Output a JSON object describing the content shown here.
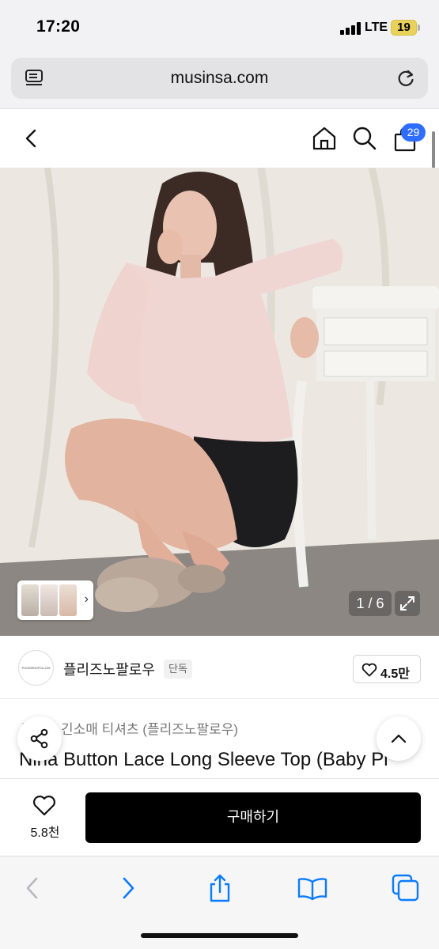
{
  "status_bar": {
    "time": "17:20",
    "network": "LTE",
    "battery": "19"
  },
  "browser": {
    "url": "musinsa.com",
    "reader_icon": "reader-icon",
    "reload_icon": "reload-icon"
  },
  "site_nav": {
    "back_icon": "chevron-left-icon",
    "home_icon": "home-icon",
    "search_icon": "search-icon",
    "cart_icon": "shopping-bag-icon",
    "cart_count": "29"
  },
  "gallery": {
    "counter": "1 / 6",
    "thumb_arrow": "›",
    "expand_icon": "expand-icon"
  },
  "brand": {
    "logo_text": "PLEASENOFOLLOW",
    "name": "플리즈노팔로우",
    "tag": "단독",
    "like_count": "4.5만"
  },
  "product": {
    "category_prefix": "상",
    "category": "긴소매 티셔츠 (플리즈노팔로우)",
    "title": "Nina Button Lace Long Sleeve Top (Baby Pi"
  },
  "purchase": {
    "wish_count": "5.8천",
    "buy_label": "구매하기"
  },
  "colors": {
    "badge_blue": "#2f6dff",
    "buy_button": "#000000",
    "safari_blue": "#0a7aff"
  }
}
